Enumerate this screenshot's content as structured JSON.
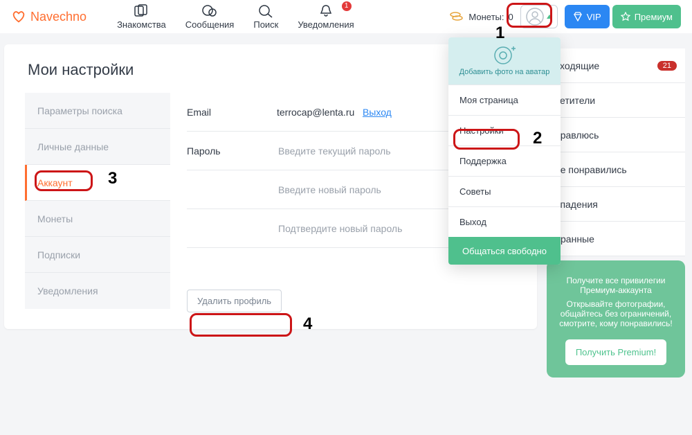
{
  "brand": "Navechno",
  "nav": {
    "dating": "Знакомства",
    "messages": "Сообщения",
    "search": "Поиск",
    "notifications": "Уведомления",
    "notif_count": "1"
  },
  "coins": {
    "label": "Монеты:",
    "value": "0"
  },
  "header_buttons": {
    "vip": "VIP",
    "premium": "Премиум"
  },
  "page_title": "Мои настройки",
  "side_tabs": {
    "search_params": "Параметры поиска",
    "personal": "Личные данные",
    "account": "Аккаунт",
    "coins": "Монеты",
    "subscriptions": "Подписки",
    "notifications": "Уведомления"
  },
  "form": {
    "email_label": "Email",
    "email_value": "terrocap@lenta.ru",
    "logout_link": "Выход",
    "password_label": "Пароль",
    "pw_current_ph": "Введите текущий пароль",
    "pw_new_ph": "Введите новый пароль",
    "pw_confirm_ph": "Подтвердите новый пароль",
    "delete_profile": "Удалить профиль"
  },
  "dropdown": {
    "add_photo": "Добавить фото на аватар",
    "my_page": "Моя страница",
    "settings": "Настройки",
    "support": "Поддержка",
    "tips": "Советы",
    "logout": "Выход",
    "chat_free": "Общаться свободно"
  },
  "right_col": {
    "incoming": "сходящие",
    "incoming_badge": "21",
    "visitors": "сетители",
    "i_like": "нравлюсь",
    "liked_me": "не понравились",
    "matches": "впадения",
    "favorites": "бранные"
  },
  "promo": {
    "line1": "Получите все привилегии Премиум-аккаунта",
    "line2": "Открывайте фотографии, общайтесь без ограничений, смотрите, кому понравились!",
    "cta": "Получить Premium!"
  },
  "annotations": {
    "n1": "1",
    "n2": "2",
    "n3": "3",
    "n4": "4"
  }
}
